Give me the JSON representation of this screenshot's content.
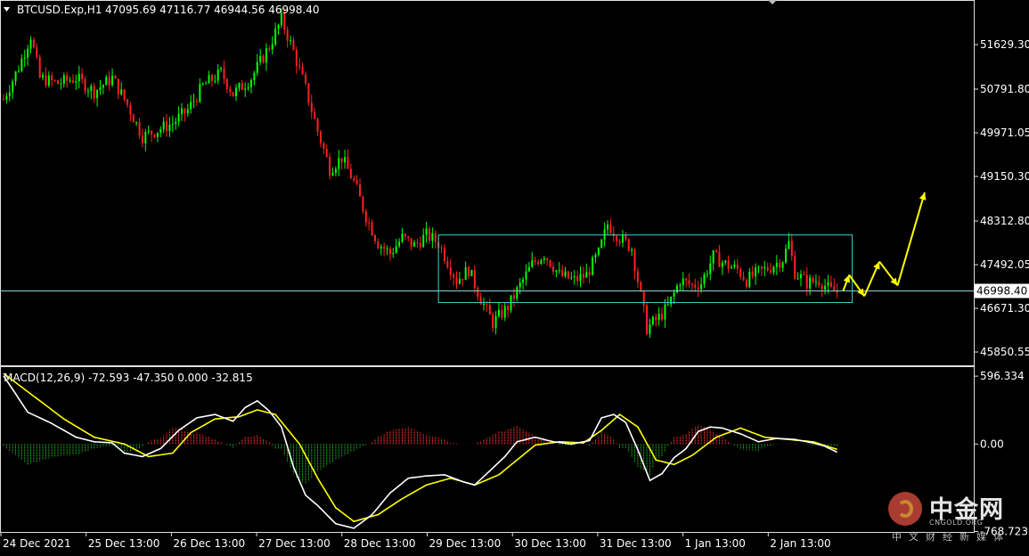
{
  "chart_data": [
    {
      "type": "candlestick",
      "title": "BTCUSD.Exp,H1",
      "ohlc_header": "47095.69 47116.77 46944.56 46998.40",
      "current_price": 46998.4,
      "current_price_label": "46998.40",
      "ylim": [
        45600,
        52450
      ],
      "y_ticks": [
        51629.3,
        50791.8,
        49971.05,
        49150.3,
        48312.8,
        47492.05,
        46671.3,
        45850.55
      ],
      "y_tick_labels": [
        "51629.30",
        "50791.80",
        "49971.05",
        "49150.30",
        "48312.80",
        "47492.05",
        "46671.30",
        "45850.55"
      ],
      "x_tick_labels": [
        "24 Dec 2021",
        "25 Dec 13:00",
        "26 Dec 13:00",
        "27 Dec 13:00",
        "28 Dec 13:00",
        "29 Dec 13:00",
        "30 Dec 13:00",
        "31 Dec 13:00",
        "1 Jan 13:00",
        "2 Jan 13:00"
      ],
      "bull_color": "#00ff00",
      "bear_color": "#ff2020",
      "price_path": [
        [
          0,
          50600
        ],
        [
          5,
          51200
        ],
        [
          9,
          51800
        ],
        [
          12,
          51000
        ],
        [
          18,
          50900
        ],
        [
          24,
          51000
        ],
        [
          30,
          50750
        ],
        [
          36,
          51000
        ],
        [
          41,
          50500
        ],
        [
          46,
          49900
        ],
        [
          50,
          50000
        ],
        [
          56,
          50150
        ],
        [
          61,
          50400
        ],
        [
          66,
          50850
        ],
        [
          72,
          51100
        ],
        [
          76,
          50700
        ],
        [
          82,
          51000
        ],
        [
          88,
          51600
        ],
        [
          92,
          52100
        ],
        [
          96,
          51500
        ],
        [
          100,
          50800
        ],
        [
          104,
          50000
        ],
        [
          108,
          49300
        ],
        [
          112,
          49500
        ],
        [
          116,
          49050
        ],
        [
          120,
          48400
        ],
        [
          124,
          47900
        ],
        [
          128,
          47700
        ],
        [
          132,
          48000
        ],
        [
          136,
          47850
        ],
        [
          140,
          48050
        ],
        [
          144,
          47900
        ],
        [
          150,
          47200
        ],
        [
          154,
          47400
        ],
        [
          158,
          46850
        ],
        [
          162,
          46400
        ],
        [
          167,
          46700
        ],
        [
          171,
          47100
        ],
        [
          175,
          47500
        ],
        [
          179,
          47700
        ],
        [
          184,
          47300
        ],
        [
          189,
          47200
        ],
        [
          193,
          47300
        ],
        [
          197,
          47700
        ],
        [
          200,
          48250
        ],
        [
          204,
          48000
        ],
        [
          208,
          47800
        ],
        [
          211,
          46900
        ],
        [
          213,
          46300
        ],
        [
          217,
          46500
        ],
        [
          220,
          46700
        ],
        [
          224,
          47200
        ],
        [
          228,
          47100
        ],
        [
          231,
          47150
        ],
        [
          235,
          47650
        ],
        [
          239,
          47500
        ],
        [
          243,
          47400
        ],
        [
          246,
          47200
        ],
        [
          250,
          47350
        ],
        [
          254,
          47450
        ],
        [
          258,
          47600
        ],
        [
          260,
          47900
        ],
        [
          262,
          47350
        ],
        [
          266,
          47150
        ],
        [
          270,
          47200
        ],
        [
          274,
          47000
        ],
        [
          276,
          46980
        ]
      ],
      "annotations": {
        "range_box": {
          "start_index": 144,
          "end_index": 281,
          "high": 48050,
          "low": 46780,
          "color": "#40d0d0"
        },
        "arrow_path": [
          [
            278,
            47000
          ],
          [
            280,
            47300
          ],
          [
            285,
            46900
          ],
          [
            290,
            47550
          ],
          [
            296,
            47100
          ],
          [
            305,
            48850
          ]
        ],
        "arrow_color": "#ffff00"
      }
    },
    {
      "type": "macd",
      "label": "MACD(12,26,9) -72.593 -47.350 0.000 -32.815",
      "ylim": [
        -780,
        660
      ],
      "y_tick_labels": [
        "596.334",
        "0.00",
        "-768.723"
      ],
      "y_ticks": [
        596.334,
        0,
        -768.723
      ],
      "macd_color": "#ffffff",
      "signal_color": "#ffff00",
      "hist_pos_color": "#ff3030",
      "hist_neg_color": "#1faa1f",
      "macd_path": [
        [
          0,
          600
        ],
        [
          8,
          280
        ],
        [
          16,
          180
        ],
        [
          24,
          60
        ],
        [
          30,
          20
        ],
        [
          36,
          10
        ],
        [
          40,
          -80
        ],
        [
          46,
          -110
        ],
        [
          52,
          -40
        ],
        [
          58,
          120
        ],
        [
          64,
          230
        ],
        [
          70,
          260
        ],
        [
          76,
          200
        ],
        [
          80,
          320
        ],
        [
          84,
          380
        ],
        [
          88,
          290
        ],
        [
          92,
          150
        ],
        [
          96,
          -200
        ],
        [
          100,
          -450
        ],
        [
          104,
          -540
        ],
        [
          110,
          -700
        ],
        [
          116,
          -740
        ],
        [
          122,
          -620
        ],
        [
          128,
          -430
        ],
        [
          134,
          -300
        ],
        [
          140,
          -280
        ],
        [
          146,
          -270
        ],
        [
          152,
          -330
        ],
        [
          156,
          -360
        ],
        [
          160,
          -260
        ],
        [
          166,
          -110
        ],
        [
          170,
          20
        ],
        [
          176,
          60
        ],
        [
          182,
          20
        ],
        [
          188,
          0
        ],
        [
          194,
          30
        ],
        [
          198,
          230
        ],
        [
          202,
          260
        ],
        [
          206,
          190
        ],
        [
          210,
          -50
        ],
        [
          214,
          -320
        ],
        [
          218,
          -260
        ],
        [
          222,
          -120
        ],
        [
          226,
          -40
        ],
        [
          230,
          110
        ],
        [
          234,
          150
        ],
        [
          238,
          140
        ],
        [
          244,
          90
        ],
        [
          250,
          20
        ],
        [
          256,
          50
        ],
        [
          262,
          40
        ],
        [
          268,
          10
        ],
        [
          272,
          -20
        ],
        [
          276,
          -72
        ]
      ],
      "signal_path": [
        [
          0,
          620
        ],
        [
          10,
          420
        ],
        [
          20,
          220
        ],
        [
          30,
          60
        ],
        [
          40,
          0
        ],
        [
          48,
          -110
        ],
        [
          56,
          -80
        ],
        [
          62,
          100
        ],
        [
          70,
          220
        ],
        [
          78,
          240
        ],
        [
          84,
          300
        ],
        [
          90,
          260
        ],
        [
          98,
          0
        ],
        [
          104,
          -300
        ],
        [
          110,
          -560
        ],
        [
          116,
          -680
        ],
        [
          124,
          -620
        ],
        [
          132,
          -480
        ],
        [
          140,
          -360
        ],
        [
          148,
          -300
        ],
        [
          156,
          -360
        ],
        [
          164,
          -270
        ],
        [
          170,
          -140
        ],
        [
          176,
          -10
        ],
        [
          184,
          20
        ],
        [
          192,
          10
        ],
        [
          198,
          120
        ],
        [
          204,
          260
        ],
        [
          210,
          150
        ],
        [
          216,
          -140
        ],
        [
          222,
          -180
        ],
        [
          228,
          -100
        ],
        [
          236,
          60
        ],
        [
          244,
          140
        ],
        [
          252,
          60
        ],
        [
          260,
          40
        ],
        [
          268,
          20
        ],
        [
          276,
          -47
        ]
      ]
    }
  ],
  "watermark": {
    "cn": "中金网",
    "en": "CNGOLD.ORG",
    "sub": "中文财经新媒体"
  }
}
